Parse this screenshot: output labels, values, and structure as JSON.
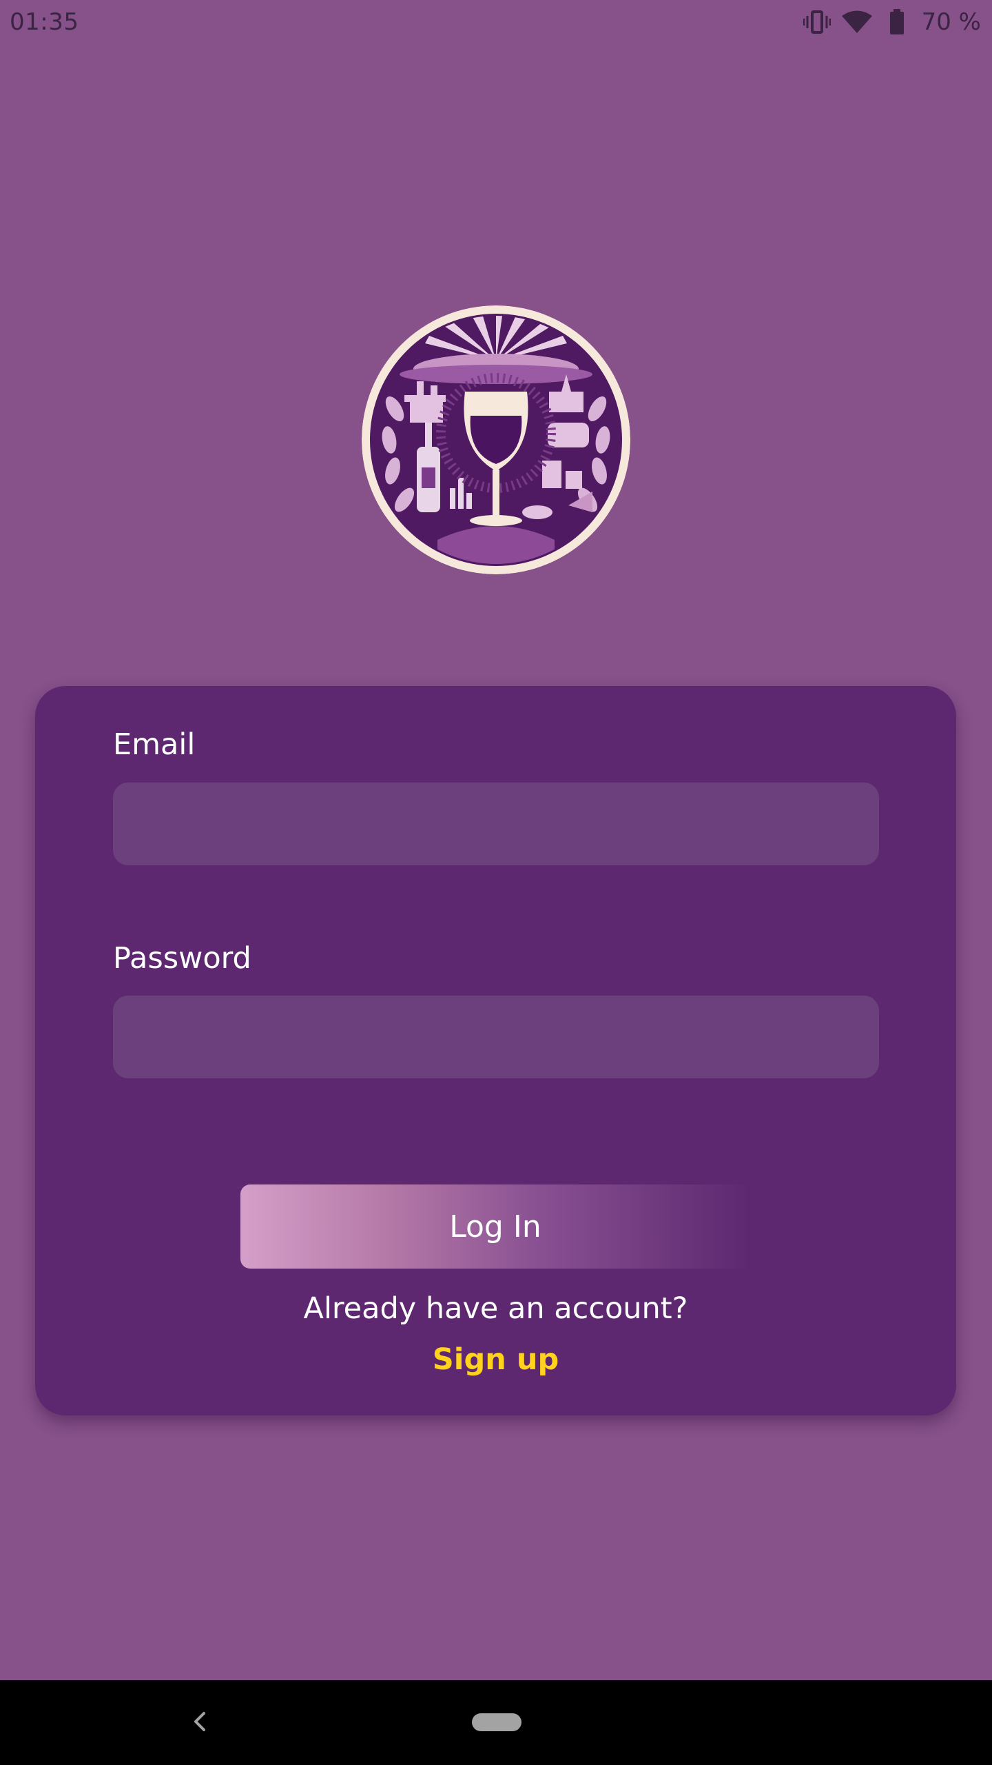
{
  "status_bar": {
    "time": "01:35",
    "battery": "70 %",
    "icons": [
      "vibrate-icon",
      "wifi-icon",
      "battery-icon"
    ]
  },
  "logo": {
    "icon": "wine-glass-emblem-icon"
  },
  "login_form": {
    "email_label": "Email",
    "email_value": "",
    "email_placeholder": "",
    "password_label": "Password",
    "password_value": "",
    "password_placeholder": "",
    "login_button": "Log In",
    "account_prompt": "Already have an account?",
    "signup_link": "Sign up"
  },
  "colors": {
    "background": "#87518a",
    "card": "#5d2870",
    "input": "#6c3f7d",
    "link": "#ffd21c",
    "text": "#ffffff"
  },
  "nav_bar": {
    "icons": [
      "back-icon",
      "home-pill-icon"
    ]
  }
}
